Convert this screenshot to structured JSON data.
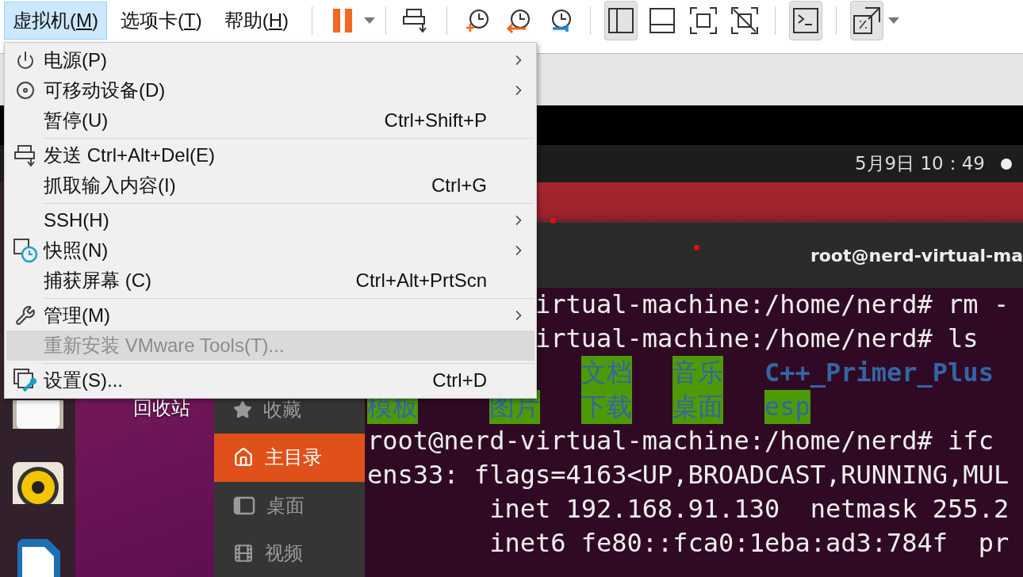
{
  "menubar": [
    {
      "before": "虚拟机(",
      "mnemonic": "M",
      "after": ")",
      "selected": true
    },
    {
      "before": "选项卡(",
      "mnemonic": "T",
      "after": ")",
      "selected": false
    },
    {
      "before": "帮助(",
      "mnemonic": "H",
      "after": ")",
      "selected": false
    }
  ],
  "toolbar": [
    [
      {
        "kind": "pause",
        "pressed": false,
        "dropdown": true
      }
    ],
    [
      {
        "kind": "send-keys",
        "pressed": false
      }
    ],
    [
      {
        "kind": "snapshot-take",
        "pressed": false
      },
      {
        "kind": "snapshot-revert",
        "pressed": false
      },
      {
        "kind": "snapshot-manager",
        "pressed": false
      }
    ],
    [
      {
        "kind": "library",
        "pressed": true
      },
      {
        "kind": "thumbnail",
        "pressed": false
      },
      {
        "kind": "fullscreen",
        "pressed": false
      },
      {
        "kind": "unity",
        "pressed": false
      }
    ],
    [
      {
        "kind": "console",
        "pressed": true
      }
    ],
    [
      {
        "kind": "stretch",
        "pressed": true,
        "dropdown": true
      }
    ]
  ],
  "menu": {
    "groups": [
      [
        {
          "kind": "power",
          "label": "电源(P)",
          "submenu": true,
          "disabled": false,
          "highlighted": false
        },
        {
          "kind": "disc",
          "label": "可移动设备(D)",
          "submenu": true,
          "disabled": false,
          "highlighted": false
        },
        {
          "label": "暂停(U)",
          "shortcut": "Ctrl+Shift+P",
          "submenu": false,
          "disabled": false,
          "highlighted": false
        }
      ],
      [
        {
          "kind": "send-keys",
          "label": "发送 Ctrl+Alt+Del(E)",
          "submenu": false,
          "disabled": false,
          "highlighted": false
        },
        {
          "label": "抓取输入内容(I)",
          "shortcut": "Ctrl+G",
          "submenu": false,
          "disabled": false,
          "highlighted": false
        }
      ],
      [
        {
          "label": "SSH(H)",
          "submenu": true,
          "disabled": false,
          "highlighted": false
        },
        {
          "kind": "snapshot",
          "label": "快照(N)",
          "submenu": true,
          "disabled": false,
          "highlighted": false
        },
        {
          "label": "捕获屏幕 (C)",
          "shortcut": "Ctrl+Alt+PrtScn",
          "submenu": false,
          "disabled": false,
          "highlighted": false
        }
      ],
      [
        {
          "kind": "wrench",
          "label": "管理(M)",
          "submenu": true,
          "disabled": false,
          "highlighted": false
        },
        {
          "label": "重新安装 VMware Tools(T)...",
          "submenu": false,
          "disabled": true,
          "highlighted": true
        }
      ],
      [
        {
          "kind": "settings",
          "label": "设置(S)...",
          "shortcut": "Ctrl+D",
          "submenu": false,
          "disabled": false,
          "highlighted": false
        }
      ]
    ]
  },
  "vm": {
    "clock": "5月9日 10：49",
    "terminal_title": "root@nerd-virtual-ma",
    "desktop_icon_label": "回收站",
    "files_sidebar": [
      {
        "kind": "star",
        "label": "收藏",
        "selected": false
      },
      {
        "kind": "home",
        "label": "主目录",
        "selected": true
      },
      {
        "kind": "desktop",
        "label": "桌面",
        "selected": false
      },
      {
        "kind": "film",
        "label": "视频",
        "selected": false
      }
    ],
    "terminal": [
      {
        "kind": "covered",
        "text": "irtual-machine:/home/nerd# rm -"
      },
      {
        "kind": "covered",
        "text": "irtual-machine:/home/nerd# ls"
      },
      {
        "kind": "ls-covered",
        "entries": [
          {
            "text": "文档",
            "highlighted": true
          },
          {
            "text": "音乐",
            "highlighted": true
          },
          {
            "text": "C++_Primer_Plus",
            "highlighted": false
          }
        ]
      },
      {
        "kind": "ls",
        "entries": [
          {
            "text": "模板",
            "highlighted": true
          },
          {
            "text": "图片",
            "highlighted": true
          },
          {
            "text": "下载",
            "highlighted": true
          },
          {
            "text": "桌面",
            "highlighted": true
          },
          {
            "text": "esp",
            "highlighted": true
          }
        ]
      },
      {
        "kind": "plain",
        "text": "root@nerd-virtual-machine:/home/nerd# ifc"
      },
      {
        "kind": "plain",
        "text": "ens33: flags=4163<UP,BROADCAST,RUNNING,MUL"
      },
      {
        "kind": "plain",
        "text": "        inet 192.168.91.130  netmask 255.2"
      },
      {
        "kind": "plain",
        "text": "        inet6 fe80::fca0:1eba:ad3:784f  pr"
      }
    ]
  }
}
